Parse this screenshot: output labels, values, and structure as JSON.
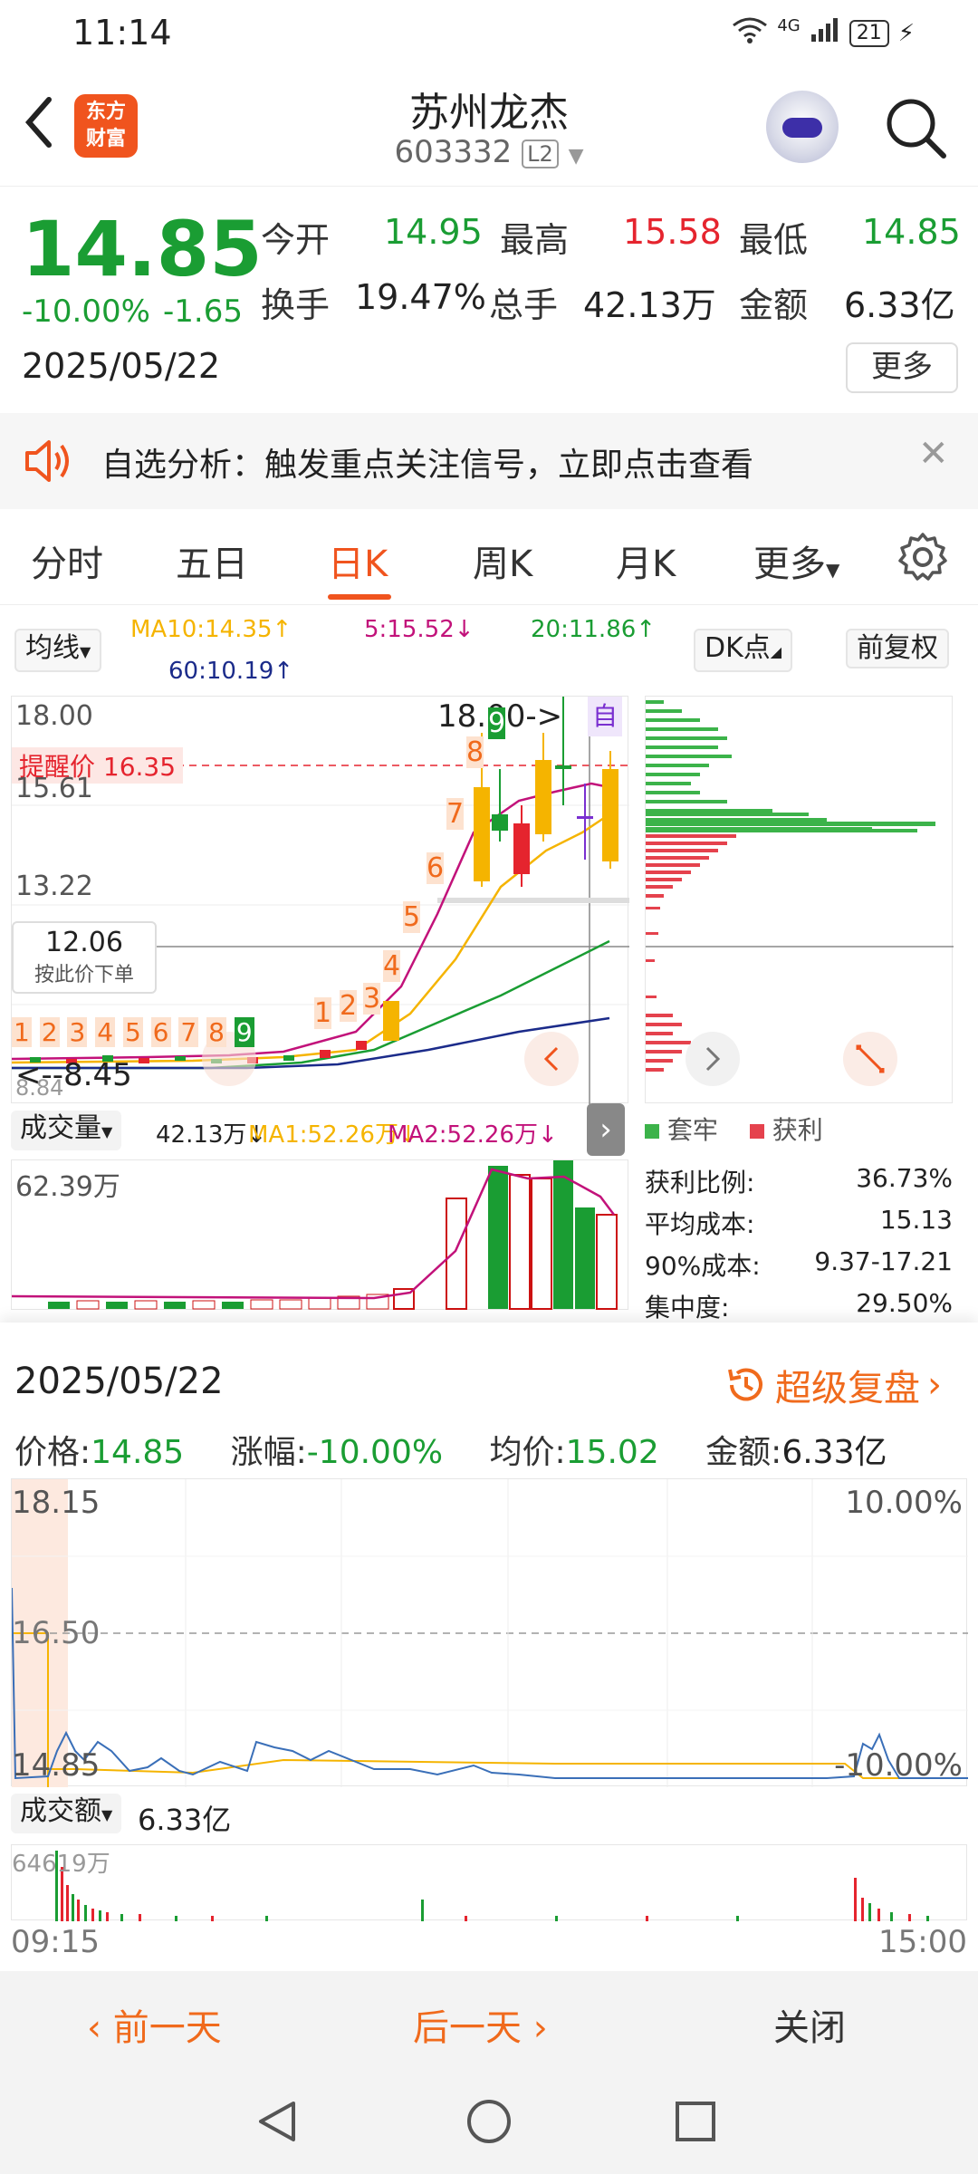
{
  "status": {
    "time": "11:14",
    "network": "4G",
    "battery": "21"
  },
  "header": {
    "stock_name": "苏州龙杰",
    "stock_code": "603332",
    "level_badge": "L2",
    "logo_line1": "东方",
    "logo_line2": "财富"
  },
  "quote": {
    "price": "14.85",
    "change_pct": "-10.00%",
    "change": "-1.65",
    "date": "2025/05/22",
    "open_label": "今开",
    "open": "14.95",
    "high_label": "最高",
    "high": "15.58",
    "low_label": "最低",
    "low": "14.85",
    "turnover_label": "换手",
    "turnover": "19.47%",
    "volume_label": "总手",
    "volume": "42.13万",
    "amount_label": "金额",
    "amount": "6.33亿",
    "more_label": "更多"
  },
  "banner": {
    "text": "自选分析：触发重点关注信号，立即点击查看"
  },
  "tabs": [
    {
      "label": "分时"
    },
    {
      "label": "五日"
    },
    {
      "label": "日K"
    },
    {
      "label": "周K"
    },
    {
      "label": "月K"
    },
    {
      "label": "更多"
    }
  ],
  "indicators": {
    "ma_select": "均线",
    "ma10": "MA10:14.35↑",
    "ma5": "5:15.52↓",
    "ma20": "20:11.86↑",
    "ma60": "60:10.19↑",
    "dk_select": "DK点",
    "rights_btn": "前复权"
  },
  "kline": {
    "price_top": "18.00",
    "alert_line": "提醒价 16.35",
    "price_2": "15.61",
    "price_3": "13.22",
    "price_current_box": "12.06",
    "order_hint": "按此价下单",
    "high_marker": "18.00->",
    "self_tag": "自",
    "low_marker": "<--8.45",
    "price_bottom": "8.84",
    "day_counts": [
      "1",
      "2",
      "3",
      "4",
      "5",
      "6",
      "7",
      "8",
      "9",
      "1",
      "2",
      "3",
      "4",
      "5",
      "6",
      "7",
      "8",
      "9"
    ]
  },
  "colors": {
    "up": "#e5242e",
    "down": "#1a9d33",
    "accent": "#f0541e",
    "ma10": "#f5b400",
    "ma5": "#c2127a",
    "ma20": "#1a9d33",
    "ma60": "#1b2b8a"
  },
  "volume_panel": {
    "select": "成交量",
    "vol": "42.13万↓",
    "ma1": "MA1:52.26万↓",
    "ma2": "MA2:52.26万↓",
    "max_label": "62.39万"
  },
  "chip_panel": {
    "legend_trapped": "套牢",
    "legend_profit": "获利",
    "rows": [
      {
        "label": "获利比例:",
        "value": "36.73%"
      },
      {
        "label": "平均成本:",
        "value": "15.13"
      },
      {
        "label": "90%成本:",
        "value": "9.37-17.21"
      },
      {
        "label": "集中度:",
        "value": "29.50%"
      }
    ]
  },
  "intraday": {
    "date": "2025/05/22",
    "super_review": "超级复盘",
    "price_label": "价格:",
    "price": "14.85",
    "change_label": "涨幅:",
    "change": "-10.00%",
    "avg_label": "均价:",
    "avg": "15.02",
    "amount_label": "金额:",
    "amount": "6.33亿",
    "y_top": "18.15",
    "y_mid": "16.50",
    "y_bottom": "14.85",
    "pct_top": "10.00%",
    "pct_bottom": "-10.00%",
    "amount_select": "成交额",
    "amount_total": "6.33亿",
    "amount_max": "64619万",
    "time_start": "09:15",
    "time_end": "15:00"
  },
  "bottom_bar": {
    "prev": "前一天",
    "next": "后一天",
    "close": "关闭"
  }
}
